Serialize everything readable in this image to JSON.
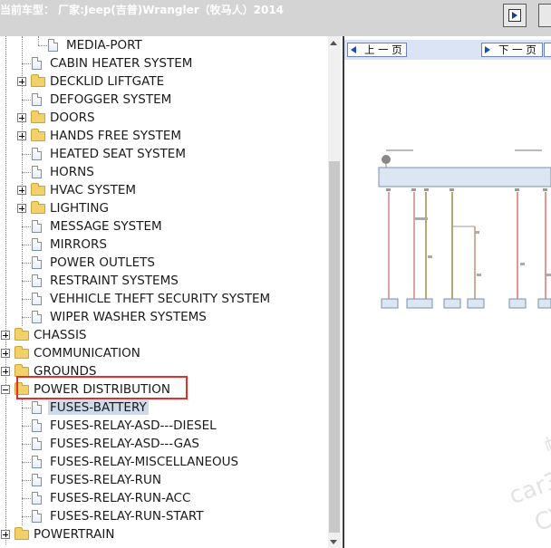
{
  "header": {
    "title": "当前车型：  厂家:Jeep(吉普)Wrangler（牧马人）2014"
  },
  "tree": {
    "items": [
      {
        "label": "MEDIA-PORT",
        "kind": "doc"
      },
      {
        "label": "CABIN HEATER SYSTEM",
        "kind": "doc"
      },
      {
        "label": "DECKLID LIFTGATE",
        "kind": "folder"
      },
      {
        "label": "DEFOGGER SYSTEM",
        "kind": "doc"
      },
      {
        "label": "DOORS",
        "kind": "folder"
      },
      {
        "label": "HANDS FREE SYSTEM",
        "kind": "folder"
      },
      {
        "label": "HEATED SEAT SYSTEM",
        "kind": "doc"
      },
      {
        "label": "HORNS",
        "kind": "doc"
      },
      {
        "label": "HVAC SYSTEM",
        "kind": "folder"
      },
      {
        "label": "LIGHTING",
        "kind": "folder"
      },
      {
        "label": "MESSAGE SYSTEM",
        "kind": "doc"
      },
      {
        "label": "MIRRORS",
        "kind": "doc"
      },
      {
        "label": "POWER OUTLETS",
        "kind": "doc"
      },
      {
        "label": "RESTRAINT SYSTEMS",
        "kind": "doc"
      },
      {
        "label": "VEHHICLE THEFT SECURITY SYSTEM",
        "kind": "doc"
      },
      {
        "label": "WIPER WASHER SYSTEMS",
        "kind": "doc"
      },
      {
        "label": "CHASSIS",
        "kind": "folder"
      },
      {
        "label": "COMMUNICATION",
        "kind": "folder"
      },
      {
        "label": "GROUNDS",
        "kind": "folder"
      },
      {
        "label": "POWER DISTRIBUTION",
        "kind": "folder-open"
      },
      {
        "label": "FUSES-BATTERY",
        "kind": "doc",
        "selected": true
      },
      {
        "label": "FUSES-RELAY-ASD---DIESEL",
        "kind": "doc"
      },
      {
        "label": "FUSES-RELAY-ASD---GAS",
        "kind": "doc"
      },
      {
        "label": "FUSES-RELAY-MISCELLANEOUS",
        "kind": "doc"
      },
      {
        "label": "FUSES-RELAY-RUN",
        "kind": "doc"
      },
      {
        "label": "FUSES-RELAY-RUN-ACC",
        "kind": "doc"
      },
      {
        "label": "FUSES-RELAY-RUN-START",
        "kind": "doc"
      },
      {
        "label": "POWERTRAIN",
        "kind": "folder"
      }
    ]
  },
  "viewer": {
    "prev_label": "上 一 页",
    "next_label": "下 一 页",
    "watermark": [
      "帕",
      "car3",
      "CY"
    ]
  },
  "colors": {
    "nav_accent": "#1b4db3",
    "selection": "#cfd9ec",
    "highlight_box": "#e0302e",
    "folder": "#f2d16b"
  }
}
